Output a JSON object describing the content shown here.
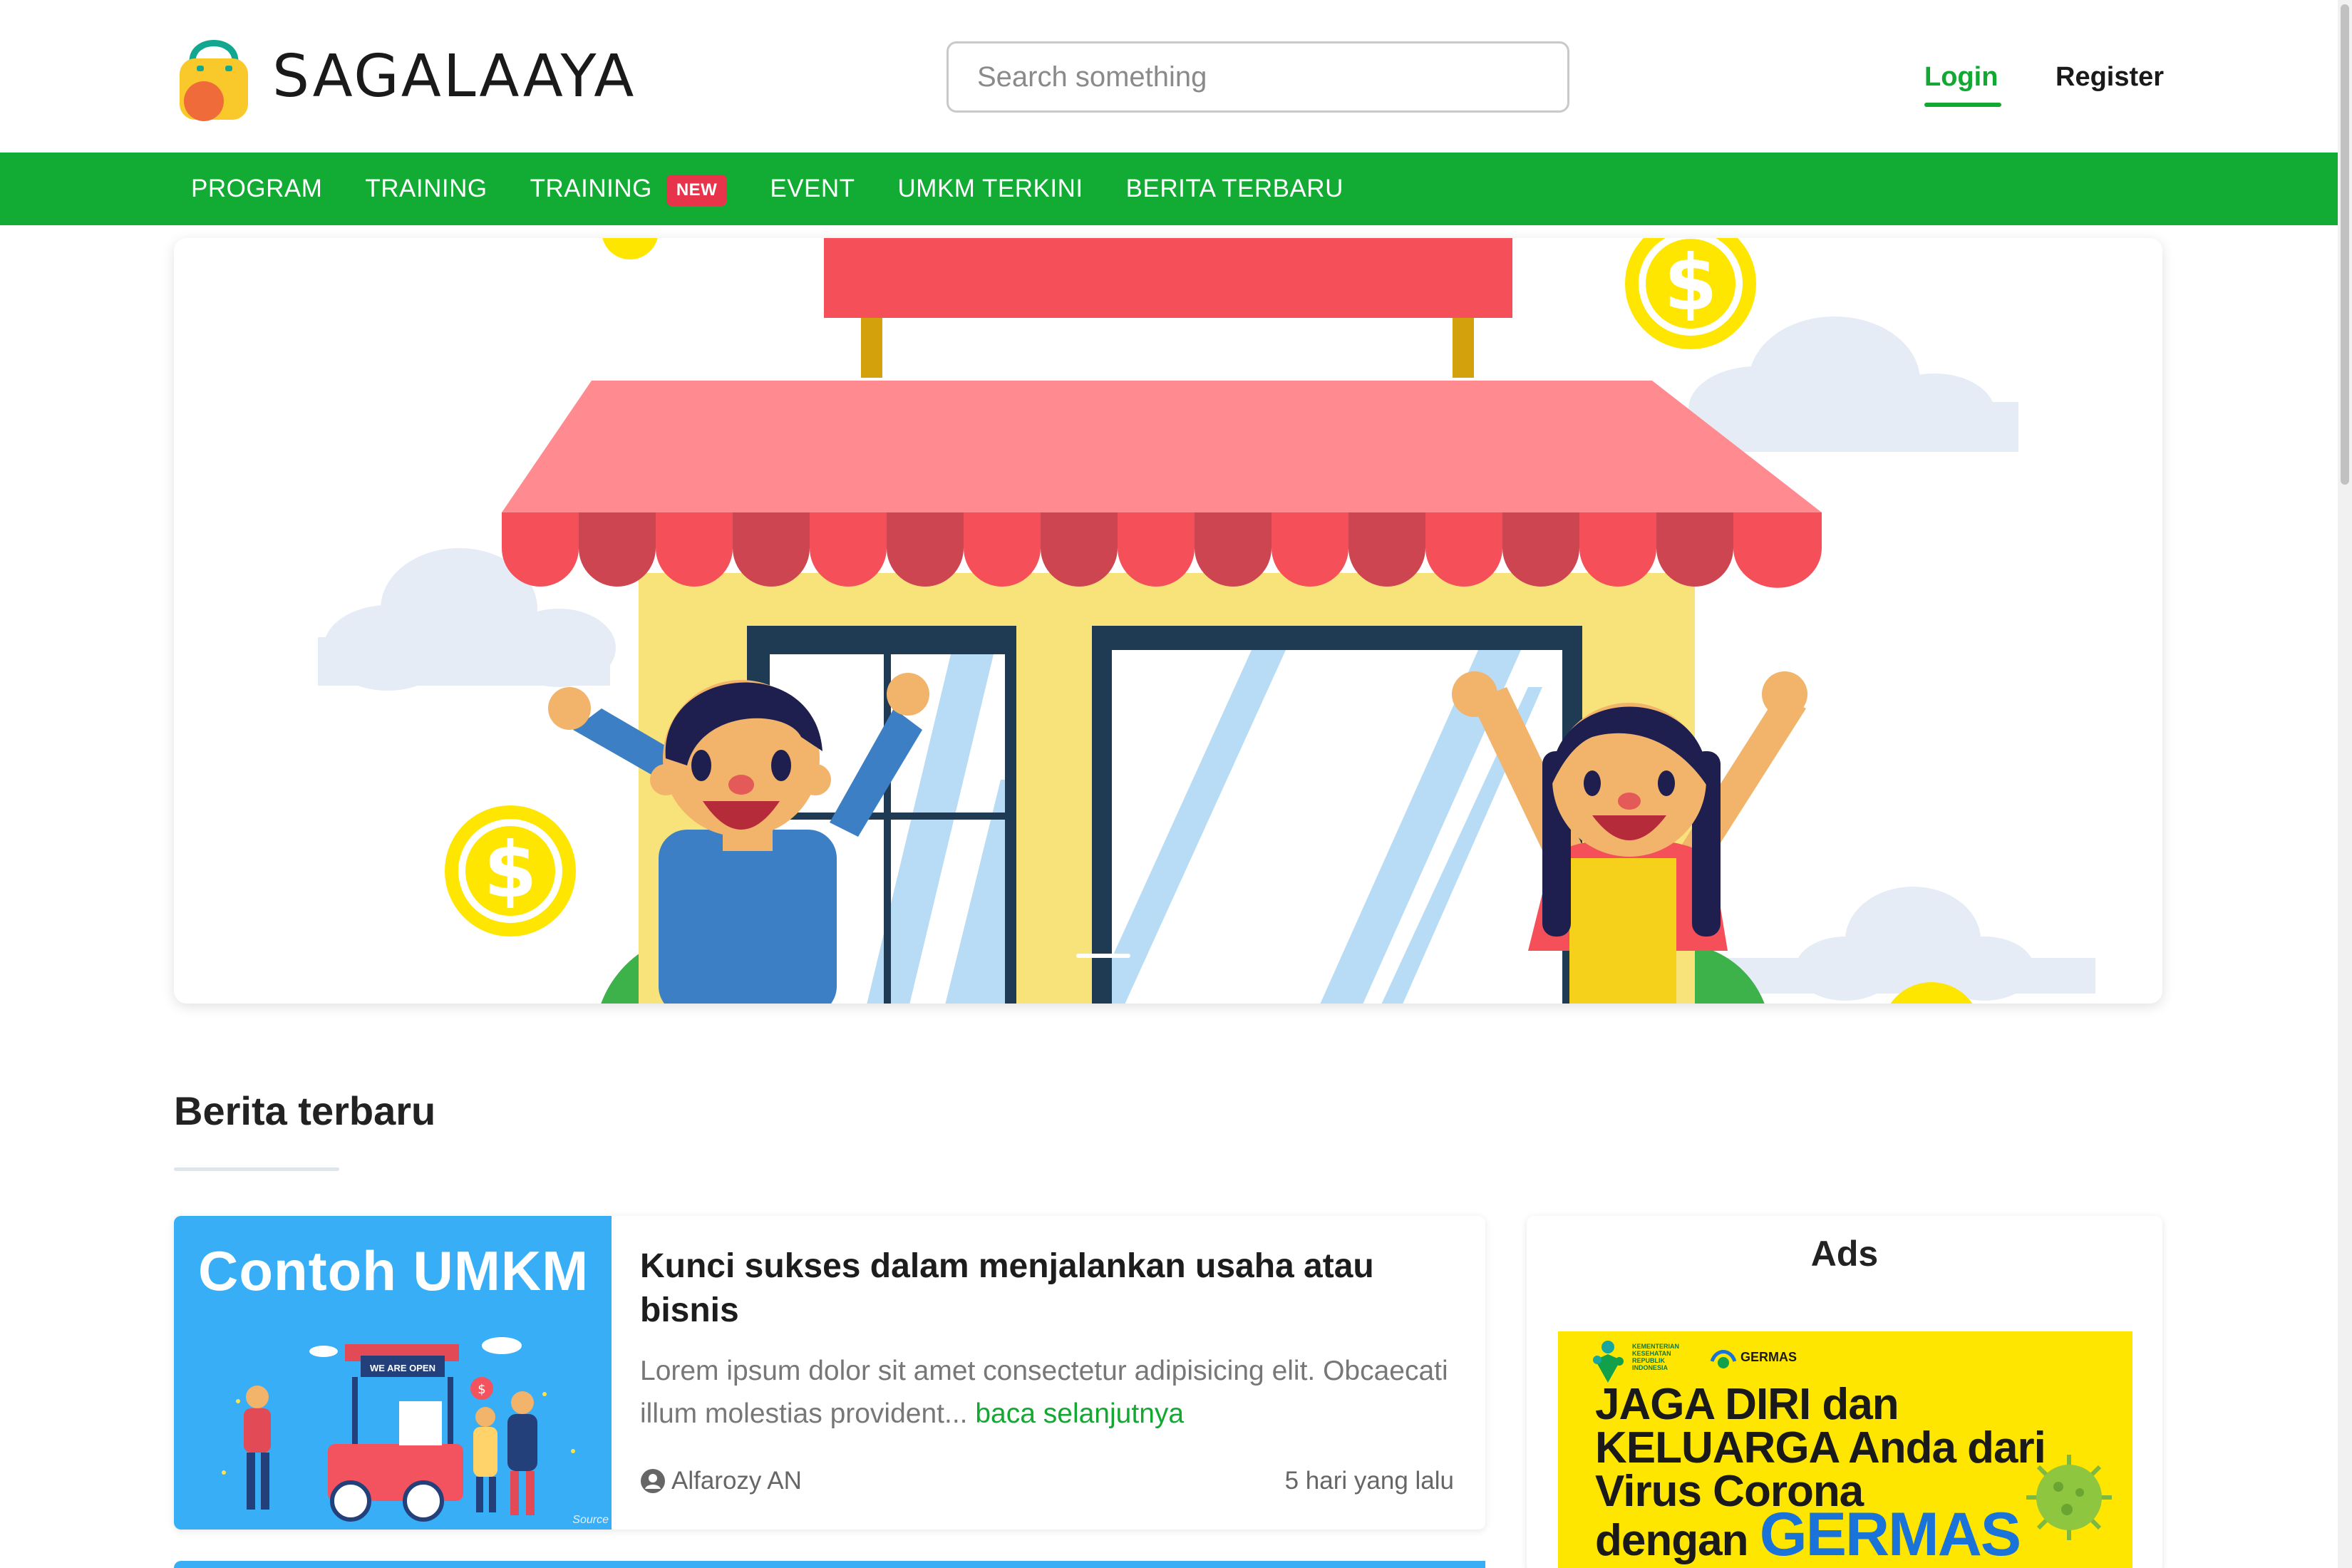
{
  "brand": {
    "name": "SAGALAAYA"
  },
  "search": {
    "placeholder": "Search something"
  },
  "auth": {
    "login": "Login",
    "register": "Register"
  },
  "nav": {
    "items": [
      {
        "label": "PROGRAM"
      },
      {
        "label": "TRAINING"
      },
      {
        "label": "TRAINING",
        "badge": "NEW"
      },
      {
        "label": "EVENT"
      },
      {
        "label": "UMKM TERKINI"
      },
      {
        "label": "BERITA TERBARU"
      }
    ]
  },
  "hero": {
    "active_slide": 1
  },
  "section": {
    "title": "Berita terbaru"
  },
  "articles": [
    {
      "thumb_title": "Contoh UMKM",
      "thumb_sign": "WE ARE OPEN",
      "thumb_source": "Source",
      "title": "Kunci sukses dalam menjalankan usaha atau bisnis",
      "excerpt": "Lorem ipsum dolor sit amet consectetur adipisicing elit. Obcaecati illum molestias provident...",
      "read_more": "baca selanjutnya",
      "author": "Alfarozy AN",
      "time": "5 hari yang lalu"
    }
  ],
  "ads": {
    "title": "Ads",
    "banner": {
      "org": "KEMENTERIAN KESEHATAN REPUBLIK INDONESIA",
      "logo": "GERMAS",
      "line1": "JAGA DIRI dan",
      "line2": "KELUARGA Anda dari",
      "line3": "Virus Corona",
      "line4": "dengan",
      "highlight": "GERMAS"
    }
  },
  "colors": {
    "brand_green": "#12ab33",
    "badge_red": "#e8344a",
    "link_green": "#12a832"
  }
}
